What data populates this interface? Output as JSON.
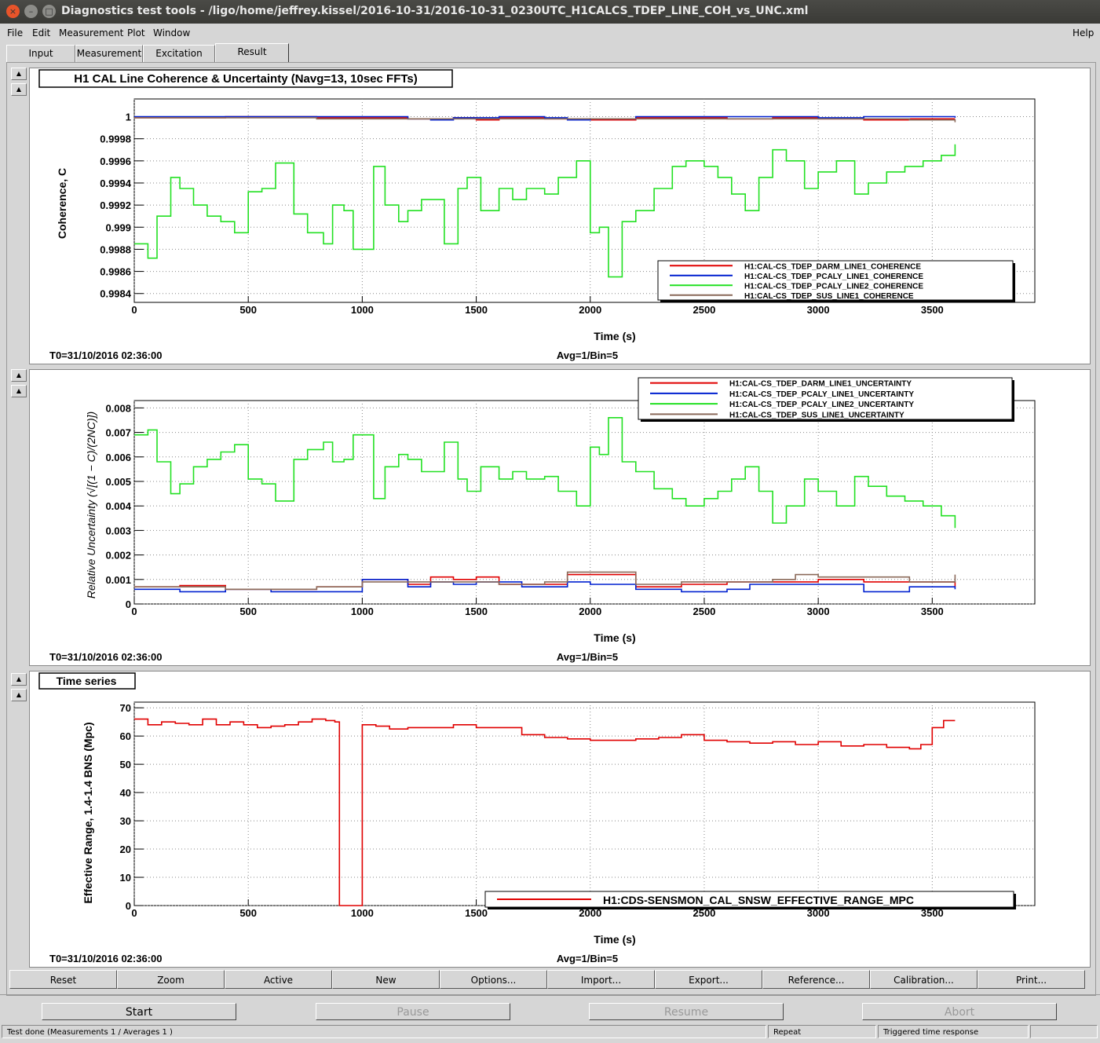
{
  "window": {
    "title": "Diagnostics test tools - /ligo/home/jeffrey.kissel/2016-10-31/2016-10-31_0230UTC_H1CALCS_TDEP_LINE_COH_vs_UNC.xml",
    "close_glyph": "×",
    "minimize_glyph": "–",
    "maximize_glyph": "□"
  },
  "menu": [
    "File",
    "Edit",
    "Measurement",
    "Plot",
    "Window"
  ],
  "help": "Help",
  "tabs": [
    "Input",
    "Measurement",
    "Excitation",
    "Result"
  ],
  "active_tab": "Result",
  "panels": [
    {
      "title": "H1 CAL Line Coherence & Uncertainty (Navg=13, 10sec FFTs)",
      "ylabel": "Coherence, C",
      "xlabel": "Time (s)",
      "t0": "T0=31/10/2016 02:36:00",
      "avg": "Avg=1/Bin=5"
    },
    {
      "title": "",
      "ylabel_italic": "Relative Uncertainty (√[(1 − C)/(2NC)])",
      "xlabel": "Time (s)",
      "t0": "T0=31/10/2016 02:36:00",
      "avg": "Avg=1/Bin=5"
    },
    {
      "title": "Time series",
      "ylabel": "Effective Range, 1.4-1.4 BNS (Mpc)",
      "xlabel": "Time (s)",
      "t0": "T0=31/10/2016 02:36:00",
      "avg": "Avg=1/Bin=5"
    }
  ],
  "chart_data": [
    {
      "type": "line",
      "title": "H1 CAL Line Coherence & Uncertainty (Navg=13, 10sec FFTs)",
      "xlabel": "Time (s)",
      "ylabel": "Coherence, C",
      "xlim": [
        0,
        3950
      ],
      "ylim": [
        0.99832,
        1.00016
      ],
      "xticks": [
        0,
        500,
        1000,
        1500,
        2000,
        2500,
        3000,
        3500
      ],
      "yticks": [
        0.9984,
        0.9986,
        0.9988,
        0.999,
        0.9992,
        0.9994,
        0.9996,
        0.9998,
        1
      ],
      "ytick_labels": [
        "0.9984",
        "0.9986",
        "0.9988",
        "0.999",
        "0.9992",
        "0.9994",
        "0.9996",
        "0.9998",
        "1"
      ],
      "grid": true,
      "legend_position": "bottom-right",
      "series": [
        {
          "name": "H1:CAL-CS_TDEP_DARM_LINE1_COHERENCE",
          "color": "#e00000",
          "x": [
            0,
            200,
            400,
            600,
            800,
            1000,
            1200,
            1400,
            1500,
            1600,
            1800,
            2000,
            2200,
            2400,
            2600,
            2800,
            3000,
            3200,
            3400,
            3600
          ],
          "values": [
            0.99999,
            0.99999,
            1.0,
            1.0,
            0.99999,
            0.99999,
            0.99998,
            0.99999,
            0.99997,
            0.99999,
            0.99998,
            0.99997,
            0.99999,
            0.99999,
            0.99998,
            0.99999,
            0.99998,
            0.99997,
            0.99998,
            0.99998
          ]
        },
        {
          "name": "H1:CAL-CS_TDEP_PCALY_LINE1_COHERENCE",
          "color": "#0020d0",
          "x": [
            0,
            200,
            400,
            600,
            800,
            1000,
            1200,
            1300,
            1400,
            1600,
            1800,
            1900,
            2000,
            2200,
            2400,
            2600,
            2800,
            3000,
            3200,
            3400,
            3600
          ],
          "values": [
            1.0,
            1.0,
            1.0,
            1.0,
            1.0,
            1.0,
            0.99998,
            0.99997,
            0.99999,
            1.0,
            0.99999,
            0.99997,
            0.99998,
            1.0,
            1.0,
            1.0,
            1.0,
            0.99999,
            1.0,
            1.0,
            0.99999
          ]
        },
        {
          "name": "H1:CAL-CS_TDEP_PCALY_LINE2_COHERENCE",
          "color": "#22e022",
          "x": [
            0,
            60,
            100,
            160,
            200,
            260,
            320,
            380,
            440,
            500,
            560,
            620,
            700,
            760,
            830,
            870,
            920,
            960,
            1050,
            1100,
            1160,
            1200,
            1260,
            1300,
            1360,
            1420,
            1460,
            1520,
            1600,
            1660,
            1720,
            1800,
            1860,
            1940,
            2000,
            2040,
            2080,
            2140,
            2200,
            2280,
            2360,
            2420,
            2500,
            2560,
            2620,
            2680,
            2740,
            2800,
            2860,
            2940,
            3000,
            3080,
            3160,
            3220,
            3300,
            3380,
            3460,
            3540,
            3600
          ],
          "values": [
            0.99885,
            0.99872,
            0.9991,
            0.99945,
            0.99935,
            0.9992,
            0.9991,
            0.99905,
            0.99895,
            0.99932,
            0.99935,
            0.99958,
            0.99912,
            0.99895,
            0.99885,
            0.9992,
            0.99915,
            0.9988,
            0.99955,
            0.9992,
            0.99905,
            0.99915,
            0.99925,
            0.99925,
            0.99885,
            0.99935,
            0.99945,
            0.99915,
            0.99935,
            0.99925,
            0.99935,
            0.9993,
            0.99945,
            0.9996,
            0.99895,
            0.999,
            0.99855,
            0.99905,
            0.99915,
            0.99935,
            0.99955,
            0.9996,
            0.99955,
            0.99945,
            0.9993,
            0.99915,
            0.99945,
            0.9997,
            0.9996,
            0.99935,
            0.9995,
            0.9996,
            0.9993,
            0.9994,
            0.9995,
            0.99955,
            0.9996,
            0.99965,
            0.99975
          ]
        },
        {
          "name": "H1:CAL-CS_TDEP_SUS_LINE1_COHERENCE",
          "color": "#8b6a5a",
          "x": [
            0,
            400,
            800,
            1200,
            1600,
            2000,
            2400,
            2800,
            3200,
            3400,
            3500,
            3600
          ],
          "values": [
            0.99999,
            0.99999,
            0.99998,
            0.99998,
            0.99998,
            0.99998,
            0.99998,
            0.99998,
            0.99998,
            0.99997,
            0.99997,
            0.99995
          ]
        }
      ]
    },
    {
      "type": "line",
      "xlabel": "Time (s)",
      "ylabel": "Relative Uncertainty (√[(1 − C)/(2NC)])",
      "xlim": [
        0,
        3950
      ],
      "ylim": [
        0,
        0.0083
      ],
      "xticks": [
        0,
        500,
        1000,
        1500,
        2000,
        2500,
        3000,
        3500
      ],
      "yticks": [
        0,
        0.001,
        0.002,
        0.003,
        0.004,
        0.005,
        0.006,
        0.007,
        0.008
      ],
      "ytick_labels": [
        "0",
        "0.001",
        "0.002",
        "0.003",
        "0.004",
        "0.005",
        "0.006",
        "0.007",
        "0.008"
      ],
      "grid": true,
      "legend_position": "top-right",
      "series": [
        {
          "name": "H1:CAL-CS_TDEP_DARM_LINE1_UNCERTAINTY",
          "color": "#e00000",
          "x": [
            0,
            200,
            400,
            600,
            800,
            1000,
            1200,
            1300,
            1400,
            1500,
            1600,
            1800,
            1900,
            2000,
            2200,
            2400,
            2600,
            2800,
            3000,
            3200,
            3400,
            3600
          ],
          "values": [
            0.0007,
            0.00075,
            0.0006,
            0.0006,
            0.0007,
            0.001,
            0.0008,
            0.0011,
            0.001,
            0.0011,
            0.0008,
            0.0008,
            0.0012,
            0.0012,
            0.0007,
            0.0008,
            0.0009,
            0.0009,
            0.001,
            0.0009,
            0.0009,
            0.0007
          ]
        },
        {
          "name": "H1:CAL-CS_TDEP_PCALY_LINE1_UNCERTAINTY",
          "color": "#0020d0",
          "x": [
            0,
            200,
            400,
            600,
            800,
            1000,
            1200,
            1300,
            1400,
            1500,
            1700,
            1900,
            2000,
            2200,
            2400,
            2600,
            2700,
            2800,
            3000,
            3200,
            3400,
            3600
          ],
          "values": [
            0.0006,
            0.0005,
            0.0006,
            0.0005,
            0.0005,
            0.001,
            0.0007,
            0.0009,
            0.0008,
            0.0009,
            0.0007,
            0.0009,
            0.0008,
            0.0006,
            0.0005,
            0.0006,
            0.0008,
            0.0008,
            0.0008,
            0.0005,
            0.0007,
            0.0006
          ]
        },
        {
          "name": "H1:CAL-CS_TDEP_PCALY_LINE2_UNCERTAINTY",
          "color": "#22e022",
          "x": [
            0,
            60,
            100,
            160,
            200,
            260,
            320,
            380,
            440,
            500,
            560,
            620,
            700,
            760,
            830,
            870,
            920,
            960,
            1050,
            1100,
            1160,
            1200,
            1260,
            1300,
            1360,
            1420,
            1460,
            1520,
            1600,
            1660,
            1720,
            1800,
            1860,
            1940,
            2000,
            2040,
            2080,
            2140,
            2200,
            2280,
            2360,
            2420,
            2500,
            2560,
            2620,
            2680,
            2740,
            2800,
            2860,
            2940,
            3000,
            3080,
            3160,
            3220,
            3300,
            3380,
            3460,
            3540,
            3600
          ],
          "values": [
            0.0069,
            0.0071,
            0.0058,
            0.0045,
            0.0049,
            0.0056,
            0.0059,
            0.0062,
            0.0065,
            0.0051,
            0.0049,
            0.0042,
            0.0059,
            0.0063,
            0.0066,
            0.0058,
            0.0059,
            0.0069,
            0.0043,
            0.0056,
            0.0061,
            0.0059,
            0.0054,
            0.0054,
            0.0066,
            0.0051,
            0.0046,
            0.0056,
            0.0051,
            0.0054,
            0.0051,
            0.0052,
            0.0046,
            0.004,
            0.0064,
            0.0061,
            0.0076,
            0.0058,
            0.0054,
            0.0047,
            0.0043,
            0.004,
            0.0043,
            0.0046,
            0.0051,
            0.0056,
            0.0046,
            0.0033,
            0.004,
            0.0051,
            0.0046,
            0.004,
            0.0052,
            0.0048,
            0.0044,
            0.0042,
            0.004,
            0.0036,
            0.0031
          ]
        },
        {
          "name": "H1:CAL-CS_TDEP_SUS_LINE1_UNCERTAINTY",
          "color": "#8b6a5a",
          "x": [
            0,
            200,
            400,
            600,
            800,
            1000,
            1200,
            1400,
            1600,
            1800,
            1900,
            2000,
            2200,
            2400,
            2600,
            2800,
            2900,
            3000,
            3200,
            3400,
            3500,
            3600
          ],
          "values": [
            0.0007,
            0.0007,
            0.0006,
            0.0006,
            0.0007,
            0.0009,
            0.0009,
            0.0009,
            0.0008,
            0.0009,
            0.0013,
            0.0013,
            0.0008,
            0.0009,
            0.0009,
            0.001,
            0.0012,
            0.0011,
            0.0011,
            0.0009,
            0.0009,
            0.0012
          ]
        }
      ]
    },
    {
      "type": "line",
      "title": "Time series",
      "xlabel": "Time (s)",
      "ylabel": "Effective Range, 1.4-1.4 BNS (Mpc)",
      "xlim": [
        0,
        3950
      ],
      "ylim": [
        0,
        72
      ],
      "xticks": [
        0,
        500,
        1000,
        1500,
        2000,
        2500,
        3000,
        3500
      ],
      "yticks": [
        0,
        10,
        20,
        30,
        40,
        50,
        60,
        70
      ],
      "ytick_labels": [
        "0",
        "10",
        "20",
        "30",
        "40",
        "50",
        "60",
        "70"
      ],
      "grid": true,
      "legend_position": "bottom-right",
      "series": [
        {
          "name": "H1:CDS-SENSMON_CAL_SNSW_EFFECTIVE_RANGE_MPC",
          "color": "#e00000",
          "x": [
            0,
            60,
            120,
            180,
            240,
            300,
            360,
            420,
            480,
            540,
            600,
            660,
            720,
            780,
            840,
            880,
            900,
            960,
            1000,
            1060,
            1120,
            1200,
            1300,
            1400,
            1500,
            1600,
            1700,
            1800,
            1900,
            2000,
            2100,
            2200,
            2300,
            2400,
            2500,
            2600,
            2700,
            2800,
            2900,
            3000,
            3100,
            3200,
            3300,
            3350,
            3400,
            3450,
            3500,
            3550,
            3600
          ],
          "values": [
            66,
            64,
            65,
            64.5,
            64,
            66,
            64,
            65,
            64,
            63,
            63.5,
            64,
            65,
            66,
            65.5,
            65,
            0,
            0,
            64,
            63.5,
            62.5,
            63,
            63,
            64,
            63,
            63,
            60.5,
            59.5,
            59,
            58.5,
            58.5,
            59,
            59.5,
            60.5,
            58.5,
            58,
            57.5,
            58,
            57,
            58,
            56.5,
            57,
            56,
            56,
            55.5,
            57,
            63,
            65.5,
            65.5
          ]
        }
      ]
    }
  ],
  "bottom_buttons": [
    "Reset",
    "Zoom",
    "Active",
    "New",
    "Options...",
    "Import...",
    "Export...",
    "Reference...",
    "Calibration...",
    "Print..."
  ],
  "control_buttons": [
    "Start",
    "Pause",
    "Resume",
    "Abort"
  ],
  "status": {
    "message": "Test done (Measurements 1 / Averages 1 )",
    "mode": "Repeat",
    "type": "Triggered time response"
  }
}
